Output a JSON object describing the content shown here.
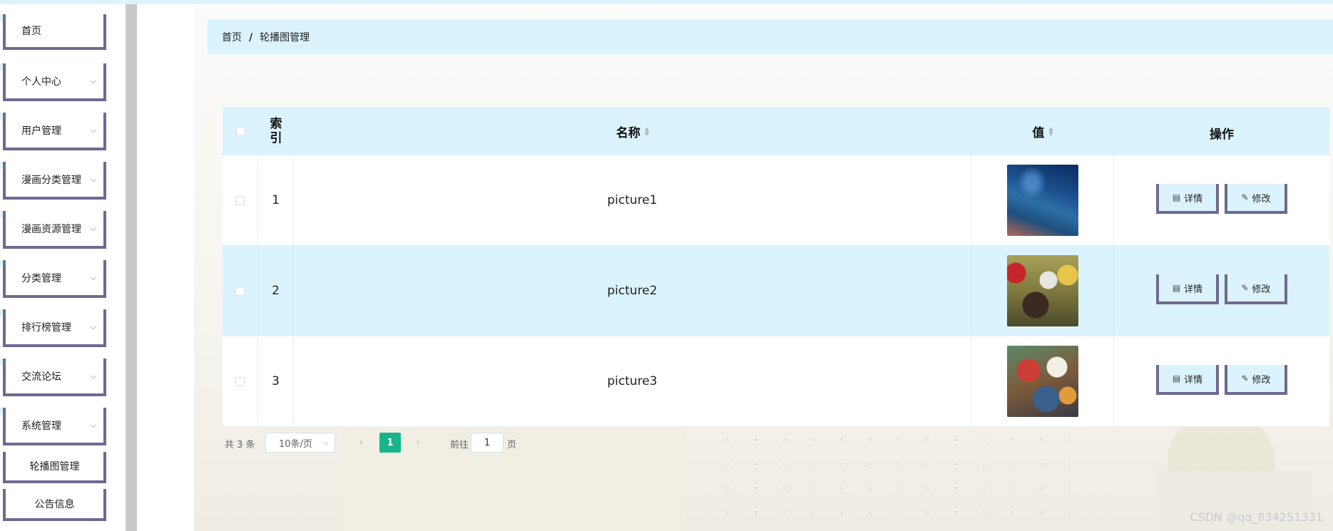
{
  "sidebar": {
    "items": [
      {
        "label": "首页",
        "has_chevron": false
      },
      {
        "label": "个人中心",
        "has_chevron": true
      },
      {
        "label": "用户管理",
        "has_chevron": true
      },
      {
        "label": "漫画分类管理",
        "has_chevron": true
      },
      {
        "label": "漫画资源管理",
        "has_chevron": true
      },
      {
        "label": "分类管理",
        "has_chevron": true
      },
      {
        "label": "排行榜管理",
        "has_chevron": true
      },
      {
        "label": "交流论坛",
        "has_chevron": true
      },
      {
        "label": "系统管理",
        "has_chevron": true
      },
      {
        "label": "轮播图管理",
        "has_chevron": false
      },
      {
        "label": "公告信息",
        "has_chevron": false
      }
    ]
  },
  "breadcrumb": {
    "home": "首页",
    "separator": "/",
    "current": "轮播图管理"
  },
  "table": {
    "headers": {
      "index": "索引",
      "name": "名称",
      "value": "值",
      "actions": "操作"
    },
    "rows": [
      {
        "index": "1",
        "name": "picture1",
        "image": "thumbnail-blue-night-sky"
      },
      {
        "index": "2",
        "name": "picture2",
        "image": "thumbnail-anime-group"
      },
      {
        "index": "3",
        "name": "picture3",
        "image": "thumbnail-anime-characters"
      }
    ],
    "actions": {
      "detail": "详情",
      "edit": "修改"
    }
  },
  "pagination": {
    "total": "共 3 条",
    "page_size": "10条/页",
    "current_page": "1",
    "goto_prefix": "前往",
    "goto_value": "1",
    "goto_suffix": "页"
  },
  "watermark": "CSDN @qq_834251331",
  "colors": {
    "accent_blue": "#dbf3fc",
    "border_purple": "#6d6a91",
    "pager_active": "#17b68a"
  }
}
